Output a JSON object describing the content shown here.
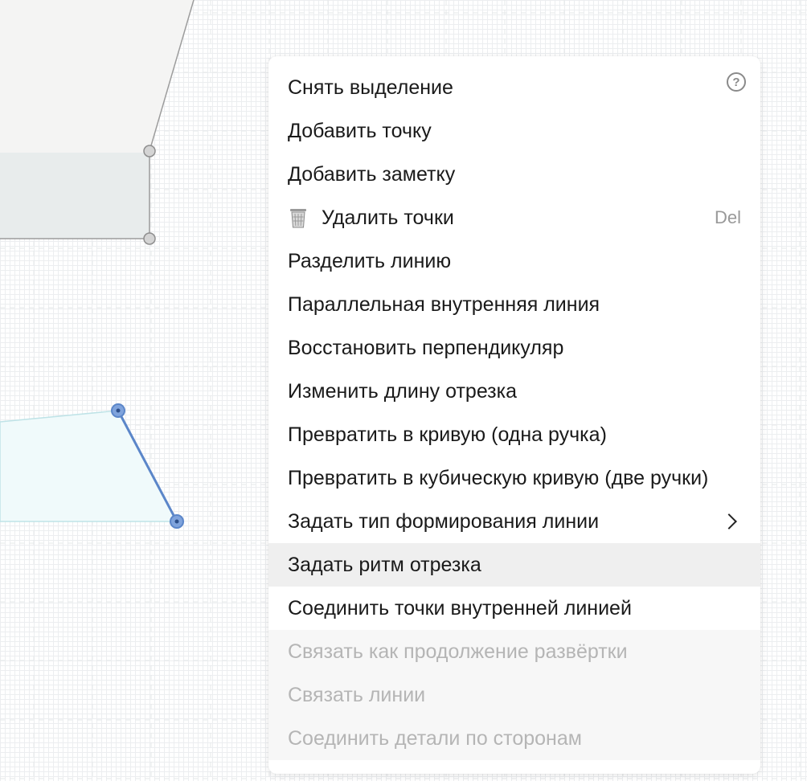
{
  "context_menu": {
    "help_icon_glyph": "?",
    "items": [
      {
        "label": "Снять выделение",
        "state": "normal"
      },
      {
        "label": "Добавить точку",
        "state": "normal"
      },
      {
        "label": "Добавить заметку",
        "state": "normal"
      },
      {
        "label": "Удалить точки",
        "state": "normal",
        "icon": "trash-icon",
        "shortcut": "Del"
      },
      {
        "label": "Разделить линию",
        "state": "normal"
      },
      {
        "label": "Параллельная внутренняя линия",
        "state": "normal"
      },
      {
        "label": "Восстановить перпендикуляр",
        "state": "normal"
      },
      {
        "label": "Изменить длину отрезка",
        "state": "normal"
      },
      {
        "label": "Превратить в кривую (одна ручка)",
        "state": "normal"
      },
      {
        "label": "Превратить в кубическую кривую (две ручки)",
        "state": "normal"
      },
      {
        "label": "Задать тип формирования линии",
        "state": "normal",
        "submenu": true
      },
      {
        "label": "Задать ритм отрезка",
        "state": "hovered"
      },
      {
        "label": "Соединить точки внутренней линией",
        "state": "normal"
      },
      {
        "label": "Связать как продолжение развёртки",
        "state": "disabled"
      },
      {
        "label": "Связать линии",
        "state": "disabled"
      },
      {
        "label": "Соединить детали по сторонам",
        "state": "disabled"
      }
    ]
  },
  "colors": {
    "selection_blue": "#5b86c9",
    "disabled_text": "#b5b5b5",
    "hover_bg": "#efefef"
  }
}
